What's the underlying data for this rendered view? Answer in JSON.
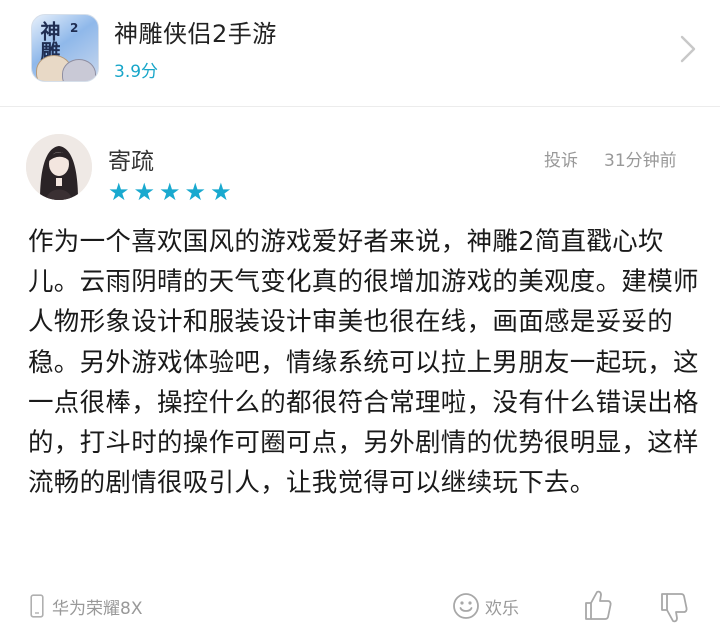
{
  "app": {
    "name": "神雕侠侣2手游",
    "rating": "3.9分",
    "icon_glyph": "神雕",
    "icon_number": "2"
  },
  "review": {
    "username": "寄疏",
    "stars": "★★★★★",
    "star_count": 5,
    "report_label": "投诉",
    "time": "31分钟前",
    "text": "作为一个喜欢国风的游戏爱好者来说，神雕2简直戳心坎儿。云雨阴晴的天气变化真的很增加游戏的美观度。建模师人物形象设计和服装设计审美也很在线，画面感是妥妥的稳。另外游戏体验吧，情缘系统可以拉上男朋友一起玩，这一点很棒，操控什么的都很符合常理啦，没有什么错误出格的，打斗时的操作可圈可点，另外剧情的优势很明显，这样流畅的剧情很吸引人，让我觉得可以继续玩下去。",
    "device": "华为荣耀8X",
    "reaction_label": "欢乐"
  },
  "colors": {
    "accent": "#19a9cf",
    "muted": "#999999",
    "text": "#1a1a1a"
  },
  "icons": [
    "chevron-right-icon",
    "phone-icon",
    "smile-icon",
    "thumb-up-icon",
    "thumb-down-icon"
  ]
}
